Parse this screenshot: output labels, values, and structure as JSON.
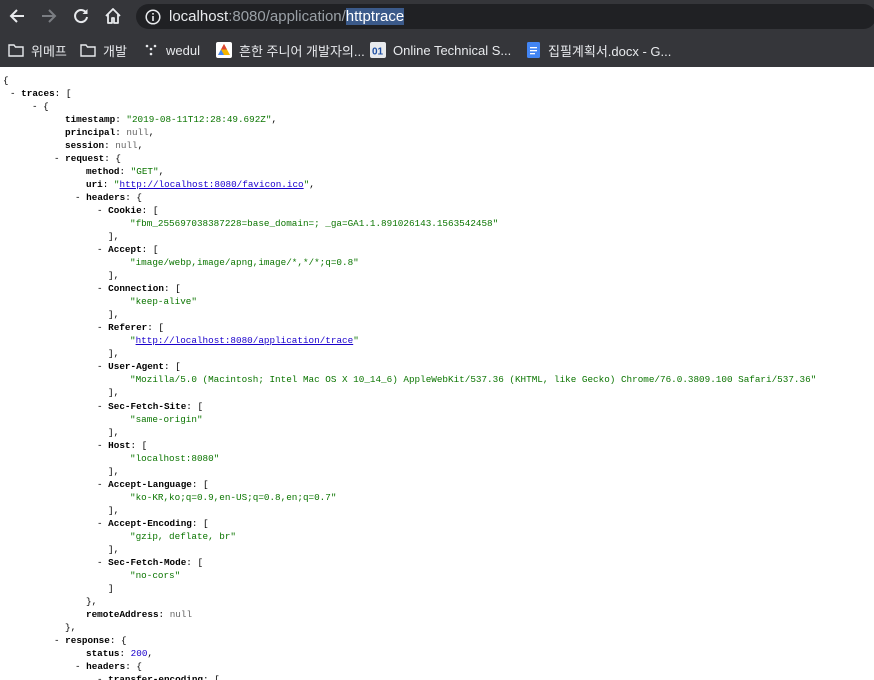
{
  "browser": {
    "url_host": "localhost",
    "url_port": ":8080/application/",
    "url_selected": "httptrace"
  },
  "bookmarks": [
    {
      "label": "위메프",
      "icon": "folder-icon"
    },
    {
      "label": "개발",
      "icon": "folder-icon"
    },
    {
      "label": "wedul",
      "icon": "dots-icon"
    },
    {
      "label": "흔한 주니어 개발자의...",
      "icon": "triangle-logo-icon"
    },
    {
      "label": "Online Technical S...",
      "icon": "o1-logo-icon"
    },
    {
      "label": "집필계획서.docx - G...",
      "icon": "google-docs-icon"
    }
  ],
  "json_lines": [
    {
      "indent": 0,
      "parts": [
        {
          "t": "t",
          "v": "{"
        }
      ]
    },
    {
      "indent": 1,
      "parts": [
        {
          "t": "t",
          "v": "- "
        },
        {
          "t": "k",
          "v": "traces"
        },
        {
          "t": "t",
          "v": ": ["
        }
      ]
    },
    {
      "indent": 2,
      "parts": [
        {
          "t": "t",
          "v": "- {"
        }
      ]
    },
    {
      "indent": 3,
      "parts": [
        {
          "t": "k",
          "v": "timestamp"
        },
        {
          "t": "t",
          "v": ": "
        },
        {
          "t": "s",
          "v": "\"2019-08-11T12:28:49.692Z\""
        },
        {
          "t": "t",
          "v": ","
        }
      ]
    },
    {
      "indent": 3,
      "parts": [
        {
          "t": "k",
          "v": "principal"
        },
        {
          "t": "t",
          "v": ": "
        },
        {
          "t": "nl",
          "v": "null"
        },
        {
          "t": "t",
          "v": ","
        }
      ]
    },
    {
      "indent": 3,
      "parts": [
        {
          "t": "k",
          "v": "session"
        },
        {
          "t": "t",
          "v": ": "
        },
        {
          "t": "nl",
          "v": "null"
        },
        {
          "t": "t",
          "v": ","
        }
      ]
    },
    {
      "indent": 3,
      "dash": true,
      "parts": [
        {
          "t": "t",
          "v": "- "
        },
        {
          "t": "k",
          "v": "request"
        },
        {
          "t": "t",
          "v": ": {"
        }
      ]
    },
    {
      "indent": 4,
      "parts": [
        {
          "t": "k",
          "v": "method"
        },
        {
          "t": "t",
          "v": ": "
        },
        {
          "t": "s",
          "v": "\"GET\""
        },
        {
          "t": "t",
          "v": ","
        }
      ]
    },
    {
      "indent": 4,
      "parts": [
        {
          "t": "k",
          "v": "uri"
        },
        {
          "t": "t",
          "v": ": "
        },
        {
          "t": "s",
          "v": "\""
        },
        {
          "t": "a",
          "v": "http://localhost:8080/favicon.ico"
        },
        {
          "t": "s",
          "v": "\""
        },
        {
          "t": "t",
          "v": ","
        }
      ]
    },
    {
      "indent": 4,
      "dash": true,
      "parts": [
        {
          "t": "t",
          "v": "- "
        },
        {
          "t": "k",
          "v": "headers"
        },
        {
          "t": "t",
          "v": ": {"
        }
      ]
    },
    {
      "indent": 5,
      "dash": true,
      "parts": [
        {
          "t": "t",
          "v": "- "
        },
        {
          "t": "k",
          "v": "Cookie"
        },
        {
          "t": "t",
          "v": ": ["
        }
      ]
    },
    {
      "indent": 6,
      "parts": [
        {
          "t": "s",
          "v": "\"fbm_255697038387228=base_domain=; _ga=GA1.1.891026143.1563542458\""
        }
      ]
    },
    {
      "indent": 5,
      "parts": [
        {
          "t": "t",
          "v": "],"
        }
      ]
    },
    {
      "indent": 5,
      "dash": true,
      "parts": [
        {
          "t": "t",
          "v": "- "
        },
        {
          "t": "k",
          "v": "Accept"
        },
        {
          "t": "t",
          "v": ": ["
        }
      ]
    },
    {
      "indent": 6,
      "parts": [
        {
          "t": "s",
          "v": "\"image/webp,image/apng,image/*,*/*;q=0.8\""
        }
      ]
    },
    {
      "indent": 5,
      "parts": [
        {
          "t": "t",
          "v": "],"
        }
      ]
    },
    {
      "indent": 5,
      "dash": true,
      "parts": [
        {
          "t": "t",
          "v": "- "
        },
        {
          "t": "k",
          "v": "Connection"
        },
        {
          "t": "t",
          "v": ": ["
        }
      ]
    },
    {
      "indent": 6,
      "parts": [
        {
          "t": "s",
          "v": "\"keep-alive\""
        }
      ]
    },
    {
      "indent": 5,
      "parts": [
        {
          "t": "t",
          "v": "],"
        }
      ]
    },
    {
      "indent": 5,
      "dash": true,
      "parts": [
        {
          "t": "t",
          "v": "- "
        },
        {
          "t": "k",
          "v": "Referer"
        },
        {
          "t": "t",
          "v": ": ["
        }
      ]
    },
    {
      "indent": 6,
      "parts": [
        {
          "t": "s",
          "v": "\""
        },
        {
          "t": "a",
          "v": "http://localhost:8080/application/trace"
        },
        {
          "t": "s",
          "v": "\""
        }
      ]
    },
    {
      "indent": 5,
      "parts": [
        {
          "t": "t",
          "v": "],"
        }
      ]
    },
    {
      "indent": 5,
      "dash": true,
      "parts": [
        {
          "t": "t",
          "v": "- "
        },
        {
          "t": "k",
          "v": "User-Agent"
        },
        {
          "t": "t",
          "v": ": ["
        }
      ]
    },
    {
      "indent": 6,
      "parts": [
        {
          "t": "s",
          "v": "\"Mozilla/5.0 (Macintosh; Intel Mac OS X 10_14_6) AppleWebKit/537.36 (KHTML, like Gecko) Chrome/76.0.3809.100 Safari/537.36\""
        }
      ]
    },
    {
      "indent": 5,
      "parts": [
        {
          "t": "t",
          "v": "],"
        }
      ]
    },
    {
      "indent": 5,
      "dash": true,
      "parts": [
        {
          "t": "t",
          "v": "- "
        },
        {
          "t": "k",
          "v": "Sec-Fetch-Site"
        },
        {
          "t": "t",
          "v": ": ["
        }
      ]
    },
    {
      "indent": 6,
      "parts": [
        {
          "t": "s",
          "v": "\"same-origin\""
        }
      ]
    },
    {
      "indent": 5,
      "parts": [
        {
          "t": "t",
          "v": "],"
        }
      ]
    },
    {
      "indent": 5,
      "dash": true,
      "parts": [
        {
          "t": "t",
          "v": "- "
        },
        {
          "t": "k",
          "v": "Host"
        },
        {
          "t": "t",
          "v": ": ["
        }
      ]
    },
    {
      "indent": 6,
      "parts": [
        {
          "t": "s",
          "v": "\"localhost:8080\""
        }
      ]
    },
    {
      "indent": 5,
      "parts": [
        {
          "t": "t",
          "v": "],"
        }
      ]
    },
    {
      "indent": 5,
      "dash": true,
      "parts": [
        {
          "t": "t",
          "v": "- "
        },
        {
          "t": "k",
          "v": "Accept-Language"
        },
        {
          "t": "t",
          "v": ": ["
        }
      ]
    },
    {
      "indent": 6,
      "parts": [
        {
          "t": "s",
          "v": "\"ko-KR,ko;q=0.9,en-US;q=0.8,en;q=0.7\""
        }
      ]
    },
    {
      "indent": 5,
      "parts": [
        {
          "t": "t",
          "v": "],"
        }
      ]
    },
    {
      "indent": 5,
      "dash": true,
      "parts": [
        {
          "t": "t",
          "v": "- "
        },
        {
          "t": "k",
          "v": "Accept-Encoding"
        },
        {
          "t": "t",
          "v": ": ["
        }
      ]
    },
    {
      "indent": 6,
      "parts": [
        {
          "t": "s",
          "v": "\"gzip, deflate, br\""
        }
      ]
    },
    {
      "indent": 5,
      "parts": [
        {
          "t": "t",
          "v": "],"
        }
      ]
    },
    {
      "indent": 5,
      "dash": true,
      "parts": [
        {
          "t": "t",
          "v": "- "
        },
        {
          "t": "k",
          "v": "Sec-Fetch-Mode"
        },
        {
          "t": "t",
          "v": ": ["
        }
      ]
    },
    {
      "indent": 6,
      "parts": [
        {
          "t": "s",
          "v": "\"no-cors\""
        }
      ]
    },
    {
      "indent": 5,
      "parts": [
        {
          "t": "t",
          "v": "]"
        }
      ]
    },
    {
      "indent": 4,
      "parts": [
        {
          "t": "t",
          "v": "},"
        }
      ]
    },
    {
      "indent": 4,
      "parts": [
        {
          "t": "k",
          "v": "remoteAddress"
        },
        {
          "t": "t",
          "v": ": "
        },
        {
          "t": "nl",
          "v": "null"
        }
      ]
    },
    {
      "indent": 3,
      "parts": [
        {
          "t": "t",
          "v": "},"
        }
      ]
    },
    {
      "indent": 3,
      "dash": true,
      "parts": [
        {
          "t": "t",
          "v": "- "
        },
        {
          "t": "k",
          "v": "response"
        },
        {
          "t": "t",
          "v": ": {"
        }
      ]
    },
    {
      "indent": 4,
      "parts": [
        {
          "t": "k",
          "v": "status"
        },
        {
          "t": "t",
          "v": ": "
        },
        {
          "t": "n",
          "v": "200"
        },
        {
          "t": "t",
          "v": ","
        }
      ]
    },
    {
      "indent": 4,
      "dash": true,
      "parts": [
        {
          "t": "t",
          "v": "- "
        },
        {
          "t": "k",
          "v": "headers"
        },
        {
          "t": "t",
          "v": ": {"
        }
      ]
    },
    {
      "indent": 5,
      "dash": true,
      "parts": [
        {
          "t": "t",
          "v": "- "
        },
        {
          "t": "k",
          "v": "transfer-encoding"
        },
        {
          "t": "t",
          "v": ": ["
        }
      ]
    }
  ]
}
